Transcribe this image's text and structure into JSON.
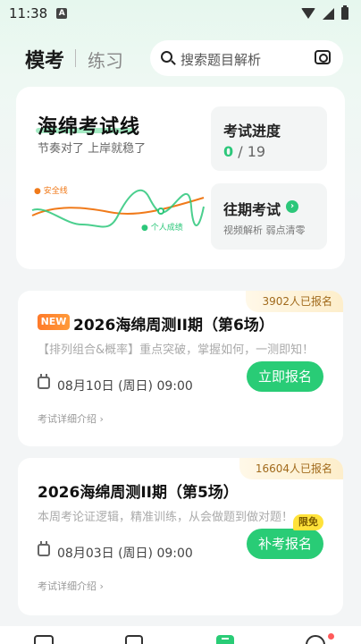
{
  "status_bar": {
    "time": "11:38",
    "sim_label": "A"
  },
  "header": {
    "tabs": [
      {
        "label": "模考",
        "active": true
      },
      {
        "label": "练习",
        "active": false
      }
    ],
    "search": {
      "placeholder": "搜索题目解析"
    }
  },
  "hero": {
    "title": "海绵考试线",
    "subtitle": "节奏对了 上岸就稳了",
    "legend": {
      "safe_line": "安全线",
      "personal_score": "个人成绩"
    },
    "progress": {
      "label": "考试进度",
      "done": "0",
      "total": "/ 19"
    },
    "past": {
      "label": "往期考试",
      "arrow": "›",
      "desc": "视频解析 弱点清零"
    }
  },
  "exams": [
    {
      "badge": "NEW",
      "title": "2026海绵周测II期（第6场）",
      "signup_count": "3902人已报名",
      "desc": "【排列组合&概率】重点突破，掌握如何，一测即知！",
      "date": "08月10日 (周日) 09:00",
      "action": "立即报名",
      "detail": "考试详细介绍 ›"
    },
    {
      "title": "2026海绵周测II期（第5场）",
      "signup_count": "16604人已报名",
      "desc": "本周考论证逻辑，精准训练，从会做题到做对题！",
      "date": "08月03日 (周日) 09:00",
      "action": "补考报名",
      "free_badge": "限免",
      "detail": "考试详细介绍 ›"
    }
  ],
  "colors": {
    "accent": "#29cc76",
    "safe_line": "#f07a1a",
    "badge_orange": "#ff7a2a",
    "free_yellow": "#ffe23a"
  }
}
